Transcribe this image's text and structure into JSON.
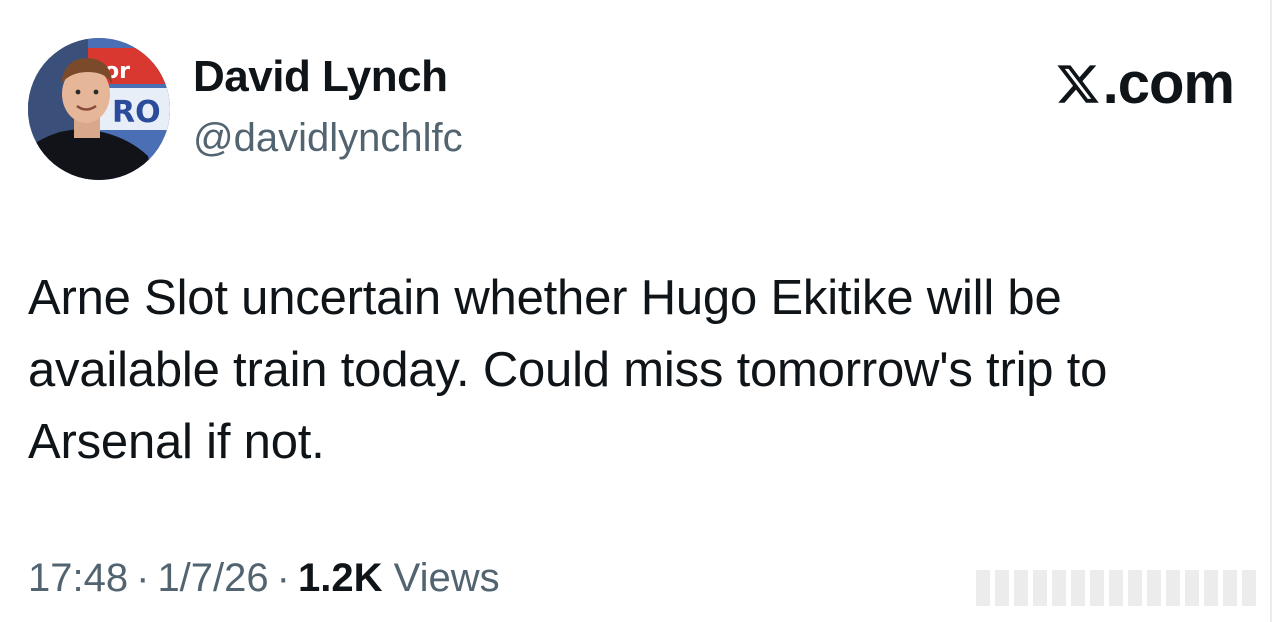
{
  "tweet": {
    "author": {
      "display_name": "David Lynch",
      "handle": "@davidlynchlfc",
      "avatar_icon": "profile-photo"
    },
    "brand": {
      "icon": "x-logo-icon",
      "label": ".com"
    },
    "text_lines": [
      "Arne Slot uncertain whether Hugo Ekitike will be",
      "available train today. Could miss tomorrow's trip to",
      "Arsenal if not."
    ],
    "meta": {
      "time": "17:48",
      "separator": "·",
      "date": "1/7/26",
      "views_count": "1.2K",
      "views_label": "Views"
    }
  },
  "colors": {
    "primary_text": "#0f1419",
    "secondary_text": "#536471",
    "background": "#ffffff"
  }
}
